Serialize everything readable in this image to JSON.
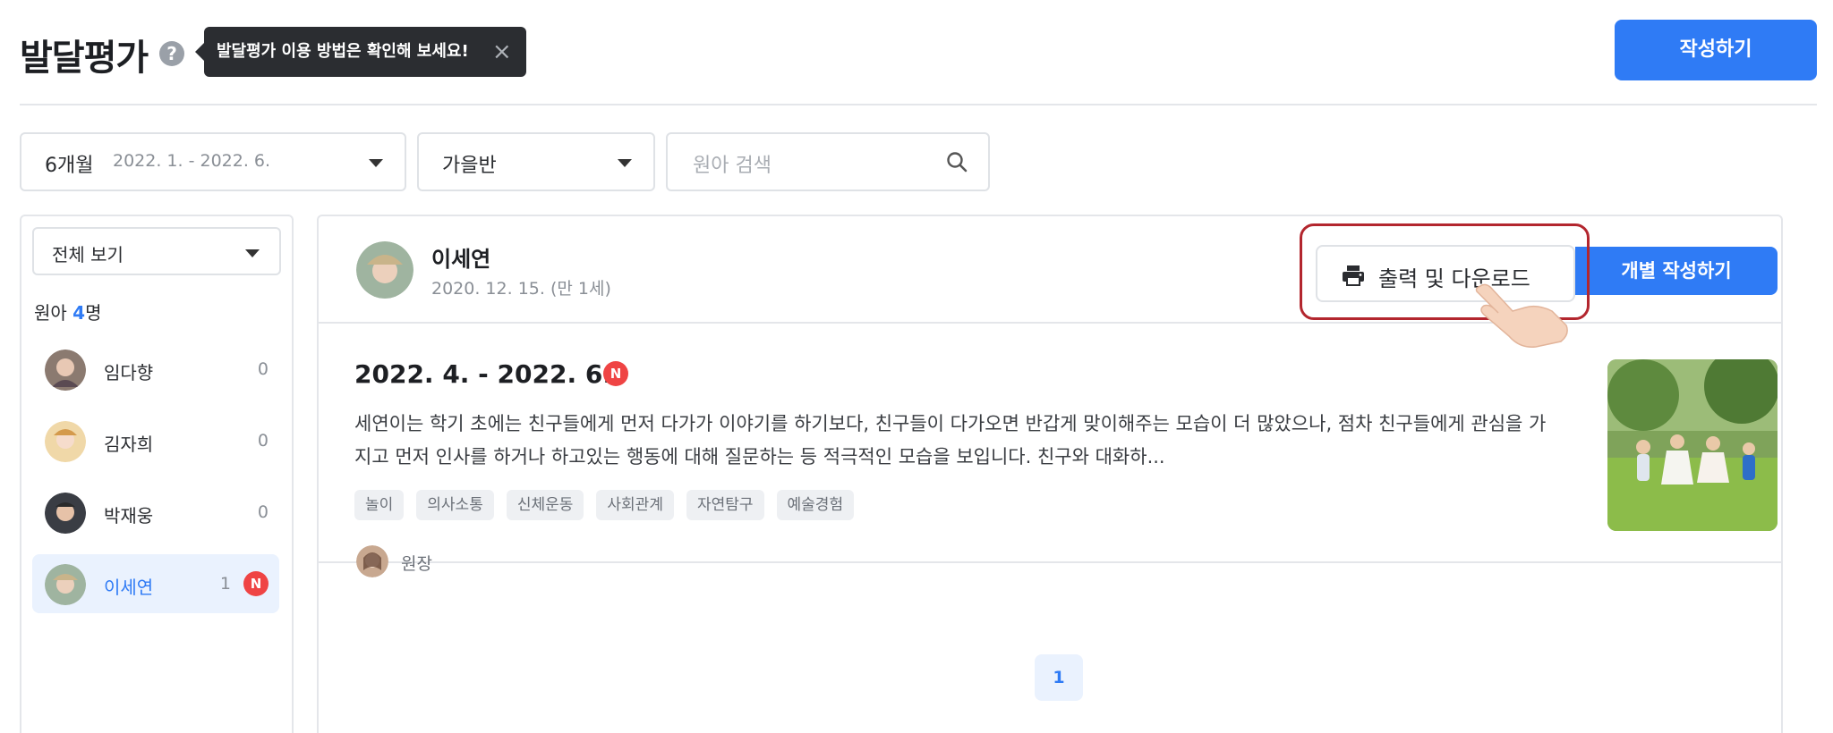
{
  "header": {
    "title": "발달평가",
    "help_icon": "help-circle-icon",
    "tooltip": "발달평가 이용 방법은 확인해 보세요!",
    "tooltip_close": "×",
    "write_button": "작성하기"
  },
  "filters": {
    "period_label": "6개월",
    "period_range": "2022. 1. - 2022. 6.",
    "class_label": "가을반",
    "search_placeholder": "원아 검색"
  },
  "sidebar": {
    "view_select": "전체 보기",
    "count_prefix": "원아",
    "count_num": "4",
    "count_suffix": "명",
    "children": [
      {
        "name": "임다향",
        "count": "0"
      },
      {
        "name": "김자희",
        "count": "0"
      },
      {
        "name": "박재웅",
        "count": "0"
      },
      {
        "name": "이세연",
        "count": "1",
        "badge": "N"
      }
    ]
  },
  "profile": {
    "name": "이세연",
    "birth": "2020. 12. 15. (만 1세)",
    "print_button": "출력 및 다운로드",
    "individual_button": "개별 작성하기"
  },
  "evaluation": {
    "period": "2022. 4. - 2022. 6.",
    "badge": "N",
    "text": "세연이는 학기 초에는 친구들에게 먼저 다가가 이야기를 하기보다, 친구들이 다가오면 반갑게 맞이해주는 모습이 더 많았으나, 점차 친구들에게 관심을 가지고 먼저 인사를 하거나 하고있는 행동에 대해 질문하는 등 적극적인 모습을 보입니다. 친구와 대화하...",
    "tags": [
      "놀이",
      "의사소통",
      "신체운동",
      "사회관계",
      "자연탐구",
      "예술경험"
    ],
    "author": "원장"
  },
  "pagination": {
    "current": "1"
  },
  "colors": {
    "accent": "#2f7bf5",
    "badge": "#ef4444",
    "highlight": "#b3262e"
  }
}
